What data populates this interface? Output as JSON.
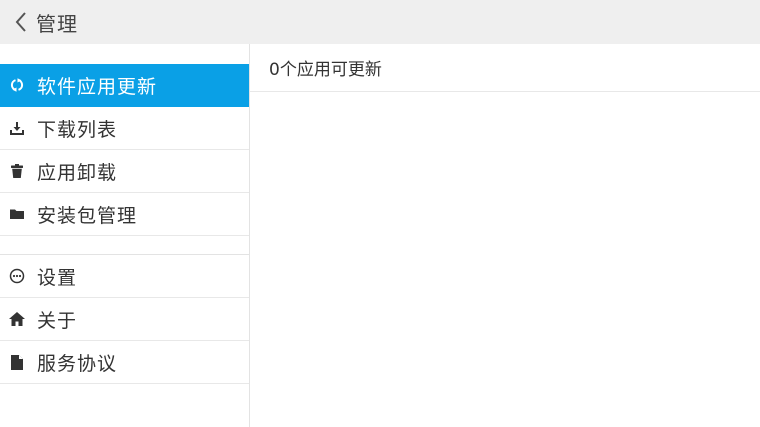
{
  "header": {
    "title": "管理"
  },
  "sidebar": {
    "groups": [
      {
        "items": [
          {
            "label": "软件应用更新",
            "icon": "refresh-icon",
            "active": true
          },
          {
            "label": "下载列表",
            "icon": "download-icon",
            "active": false
          },
          {
            "label": "应用卸载",
            "icon": "trash-icon",
            "active": false
          },
          {
            "label": "安装包管理",
            "icon": "folder-icon",
            "active": false
          }
        ]
      },
      {
        "items": [
          {
            "label": "设置",
            "icon": "settings-circle-icon",
            "active": false
          },
          {
            "label": "关于",
            "icon": "home-icon",
            "active": false
          },
          {
            "label": "服务协议",
            "icon": "document-icon",
            "active": false
          }
        ]
      }
    ]
  },
  "main": {
    "update_count_text": "0个应用可更新"
  },
  "colors": {
    "accent": "#0aa0e6",
    "header_bg": "#efefef",
    "divider": "#e8e8e8"
  }
}
